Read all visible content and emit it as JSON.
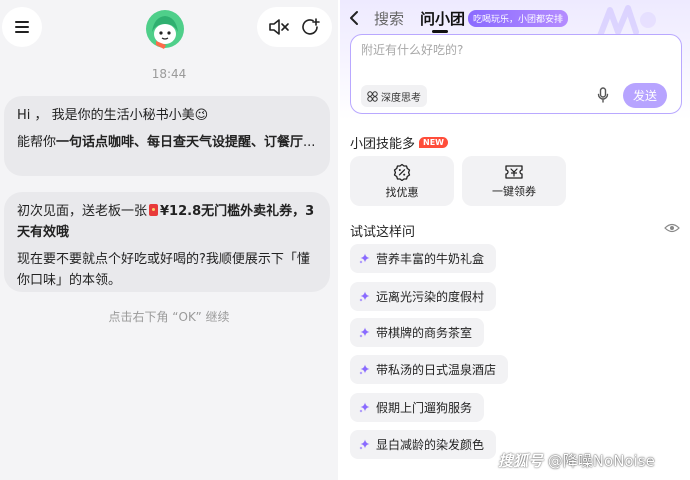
{
  "left": {
    "time": "18:44",
    "msg1": {
      "line1": "Hi ， 我是你的生活小秘书小美😉",
      "line2_prefix": "能帮你",
      "line2_bold": "一句话点咖啡、每日查天气设提醒、订餐厅",
      "line2_suffix": "..."
    },
    "msg2": {
      "line1_prefix": "初次见面，送老板一张",
      "line1_bold": "¥12.8无门槛外卖礼券，3天有效哦",
      "line2": "现在要不要就点个好吃或好喝的?我顺便展示下「懂你口味」的本领。"
    },
    "hint": "点击右下角 “OK” 继续"
  },
  "right": {
    "nav": {
      "search_tab": "搜索",
      "active_tab": "问小团",
      "badge": "吃喝玩乐，小团都安排"
    },
    "input": {
      "placeholder": "附近有什么好吃的?",
      "deep_think": "深度思考",
      "send": "发送"
    },
    "skills": {
      "title": "小团技能多",
      "new_badge": "NEW",
      "items": [
        {
          "label": "找优惠",
          "icon": "discount-icon"
        },
        {
          "label": "一键领券",
          "icon": "coupon-icon"
        }
      ]
    },
    "suggestions": {
      "title": "试试这样问",
      "items": [
        {
          "label": "营养丰富的牛奶礼盒"
        },
        {
          "label": "远离光污染的度假村"
        },
        {
          "label": "带棋牌的商务茶室"
        },
        {
          "label": "带私汤的日式温泉酒店"
        },
        {
          "label": "假期上门遛狗服务"
        },
        {
          "label": "显白减龄的染发颜色"
        }
      ]
    }
  },
  "watermark": {
    "brand": "搜狐号",
    "text": "@降噪NoNoise"
  },
  "colors": {
    "accent": "#b7a4ff",
    "new_badge": "#ff4d3a",
    "bubble": "#e9e9ec"
  }
}
